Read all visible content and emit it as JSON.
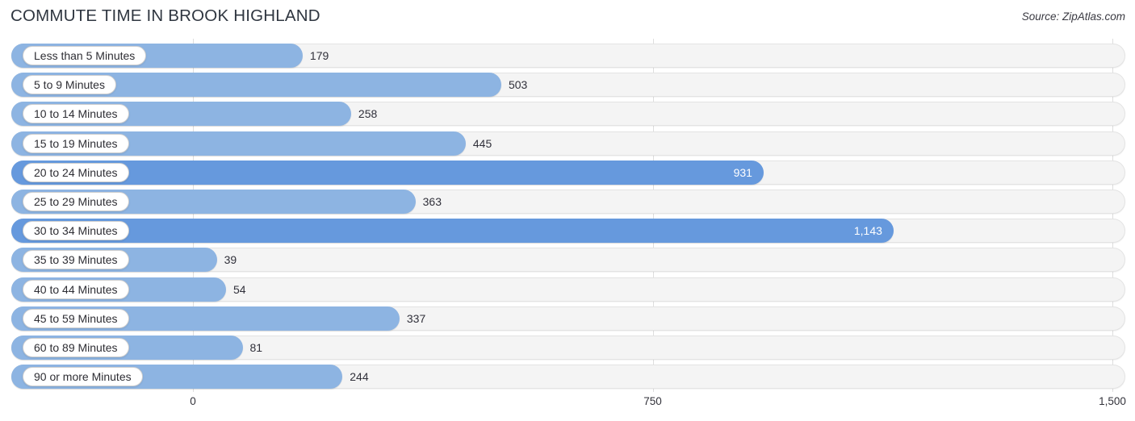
{
  "header": {
    "title": "COMMUTE TIME IN BROOK HIGHLAND",
    "source": "Source: ZipAtlas.com"
  },
  "colors": {
    "bar": "#8db4e2",
    "bar_accent": "#6699dd",
    "track": "#f4f4f4",
    "track_border": "#e3e3e3",
    "gridline": "#dedede",
    "title_text": "#2f3640",
    "value_text": "#30303a",
    "value_text_inside": "#ffffff"
  },
  "chart_data": {
    "type": "bar",
    "orientation": "horizontal",
    "title": "COMMUTE TIME IN BROOK HIGHLAND",
    "xlabel": "",
    "ylabel": "",
    "xlim": [
      0,
      1500
    ],
    "grid": true,
    "legend": null,
    "xticks": [
      0,
      750,
      1500
    ],
    "xtick_labels": [
      "0",
      "750",
      "1,500"
    ],
    "categories": [
      "Less than 5 Minutes",
      "5 to 9 Minutes",
      "10 to 14 Minutes",
      "15 to 19 Minutes",
      "20 to 24 Minutes",
      "25 to 29 Minutes",
      "30 to 34 Minutes",
      "35 to 39 Minutes",
      "40 to 44 Minutes",
      "45 to 59 Minutes",
      "60 to 89 Minutes",
      "90 or more Minutes"
    ],
    "values": [
      179,
      503,
      258,
      445,
      931,
      363,
      1143,
      39,
      54,
      337,
      81,
      244
    ],
    "value_labels": [
      "179",
      "503",
      "258",
      "445",
      "931",
      "363",
      "1,143",
      "39",
      "54",
      "337",
      "81",
      "244"
    ],
    "label_inside": [
      false,
      false,
      false,
      false,
      true,
      false,
      true,
      false,
      false,
      false,
      false,
      false
    ]
  }
}
